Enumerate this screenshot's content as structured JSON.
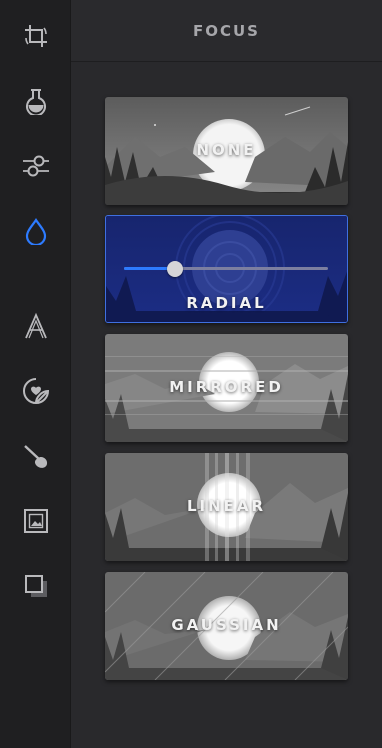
{
  "panel": {
    "title": "FOCUS"
  },
  "toolbar": {
    "tools": [
      {
        "icon": "crop-rotate-icon",
        "active": false
      },
      {
        "icon": "flask-icon",
        "active": false
      },
      {
        "icon": "adjust-sliders-icon",
        "active": false
      },
      {
        "icon": "drop-icon",
        "active": true
      },
      {
        "icon": "text-icon",
        "active": false
      },
      {
        "icon": "sticker-icon",
        "active": false
      },
      {
        "icon": "brush-icon",
        "active": false
      },
      {
        "icon": "frame-icon",
        "active": false
      },
      {
        "icon": "overlay-icon",
        "active": false
      }
    ],
    "accent_color": "#2d7bff"
  },
  "filters": {
    "none": {
      "label": "NONE"
    },
    "radial": {
      "label": "RADIAL",
      "intensity": 0.25
    },
    "mirrored": {
      "label": "MIRRORED"
    },
    "linear": {
      "label": "LINEAR"
    },
    "gaussian": {
      "label": "GAUSSIAN"
    }
  }
}
